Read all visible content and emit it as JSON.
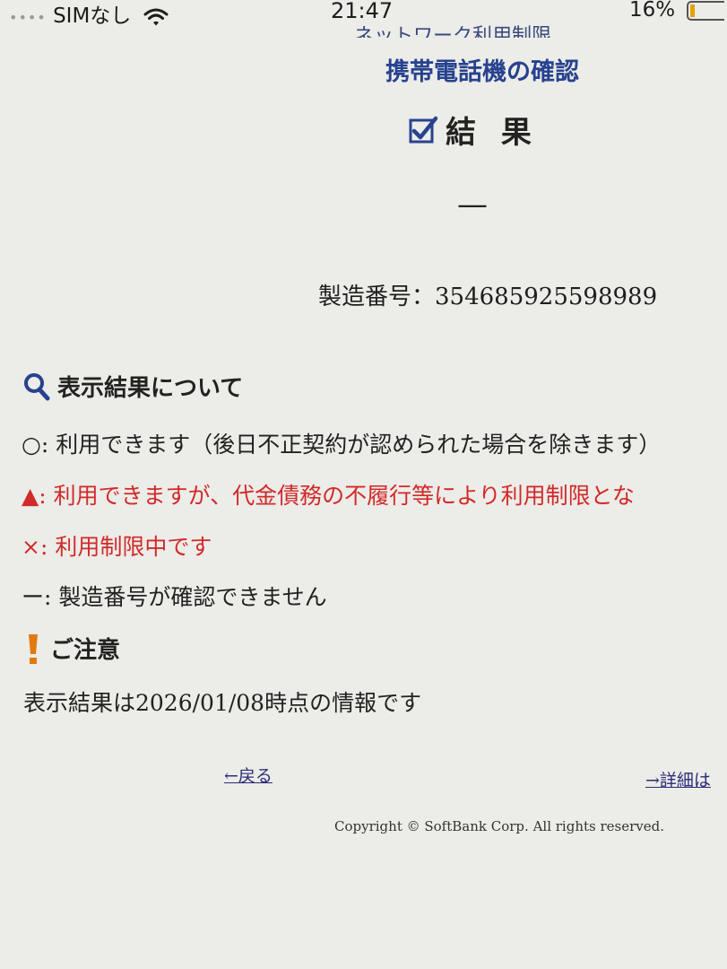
{
  "status_bar": {
    "carrier": "SIMなし",
    "time": "21:47",
    "battery": "16%",
    "battery_level": 0.16
  },
  "header": {
    "cut_title": "ネットワーク利用制限",
    "subtitle": "携帯電話機の確認",
    "result_heading": "結 果"
  },
  "result": {
    "value": "—",
    "serial_label": "製造番号：",
    "serial_number": "354685925598989"
  },
  "legend": {
    "title": "表示結果について",
    "items": [
      {
        "symbol": "○:",
        "text": " 利用できます（後日不正契約が認められた場合を除きます）"
      },
      {
        "symbol": "▲:",
        "text": " 利用できますが、代金債務の不履行等により利用制限とな"
      },
      {
        "symbol": "×:",
        "text": " 利用制限中です"
      },
      {
        "symbol": "ー:",
        "text": " 製造番号が確認できません"
      }
    ]
  },
  "notice": {
    "title": "ご注意",
    "text": "表示結果は2026/01/08時点の情報です"
  },
  "links": {
    "back": "←戻る",
    "details": "→詳細は"
  },
  "footer": {
    "copyright": "Copyright © SoftBank Corp. All rights reserved."
  },
  "colors": {
    "accent_blue": "#27428f",
    "warning_red": "#d12a2a",
    "notice_orange": "#e07a10"
  }
}
